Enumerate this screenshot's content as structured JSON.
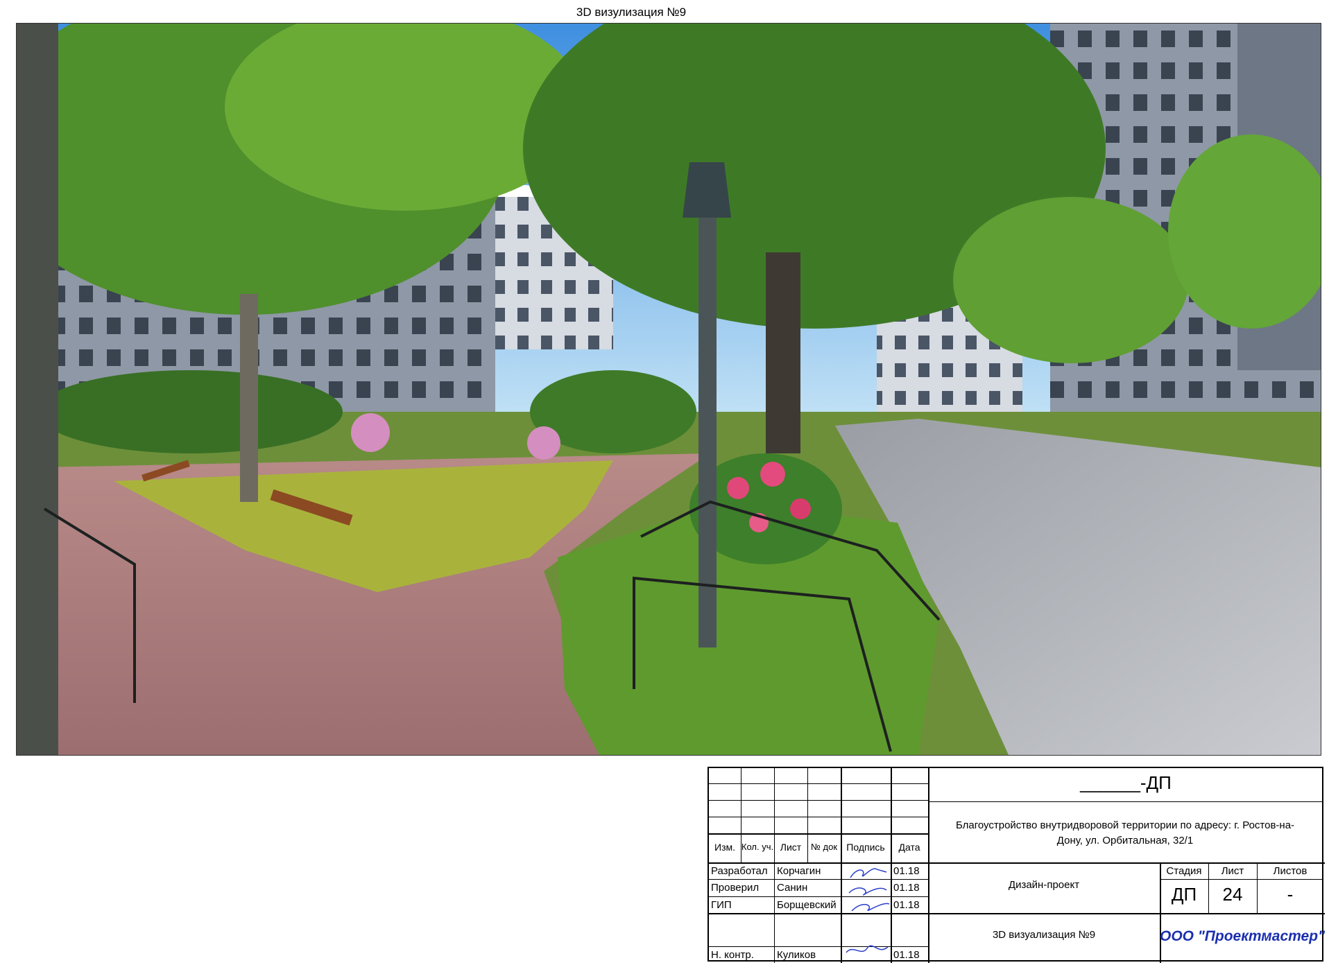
{
  "sheet_title": "3D визулизация №9",
  "stamp": {
    "doc_code": "______-ДП",
    "project_description": "Благоустройство внутридворовой территории по адресу: г. Ростов-на-Дону, ул. Орбитальная, 32/1",
    "headers": {
      "izm": "Изм.",
      "kol_uch": "Кол. уч.",
      "list": "Лист",
      "n_dok": "№ док",
      "podpis": "Подпись",
      "data": "Дата"
    },
    "roles": [
      {
        "role": "Разработал",
        "name": "Корчагин",
        "date": "01.18"
      },
      {
        "role": "Проверил",
        "name": "Санин",
        "date": "01.18"
      },
      {
        "role": "ГИП",
        "name": "Борщевский",
        "date": "01.18"
      },
      {
        "role": "Н. контр.",
        "name": "Куликов",
        "date": "01.18"
      }
    ],
    "stage_header": "Стадия",
    "sheet_header": "Лист",
    "sheets_header": "Листов",
    "stage": "ДП",
    "sheet": "24",
    "sheets": "-",
    "project_type": "Дизайн-проект",
    "drawing_name": "3D визуализация №9",
    "company": "ООО \"Проектмастер\""
  }
}
